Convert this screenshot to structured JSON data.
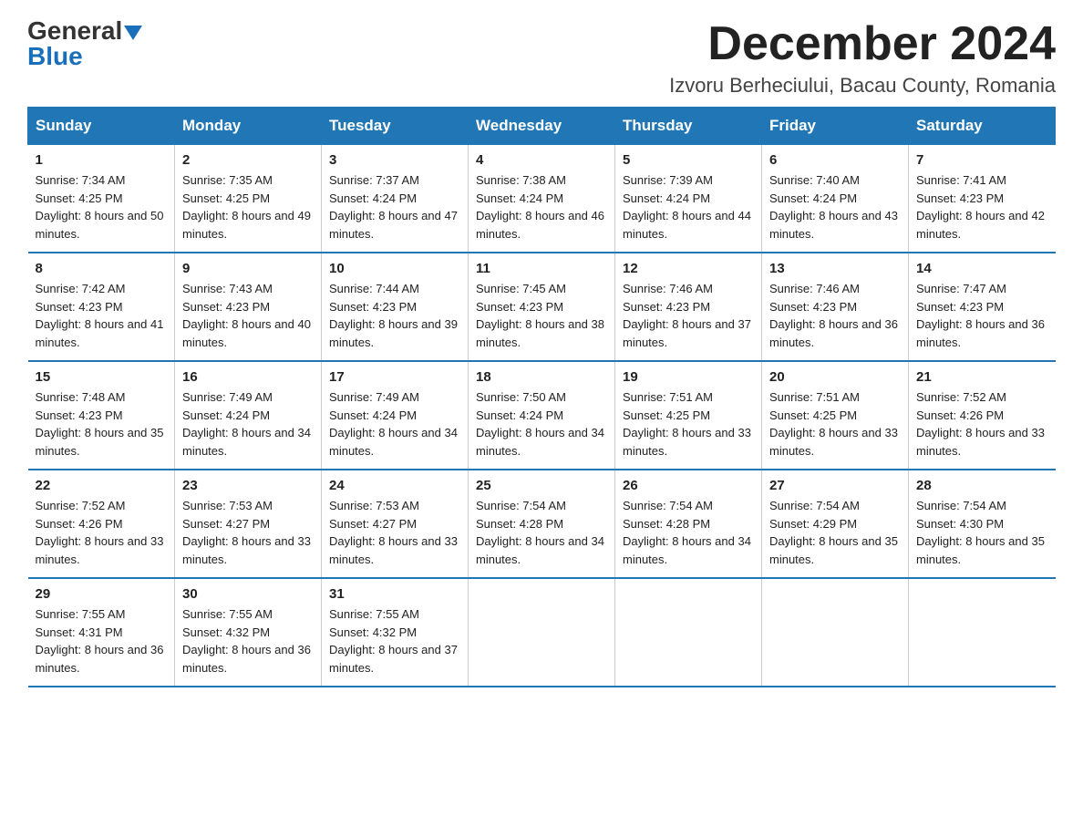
{
  "header": {
    "logo_line1": "General",
    "logo_line2": "Blue",
    "month_title": "December 2024",
    "location": "Izvoru Berheciului, Bacau County, Romania"
  },
  "days_of_week": [
    "Sunday",
    "Monday",
    "Tuesday",
    "Wednesday",
    "Thursday",
    "Friday",
    "Saturday"
  ],
  "weeks": [
    [
      {
        "day": "1",
        "sunrise": "7:34 AM",
        "sunset": "4:25 PM",
        "daylight": "8 hours and 50 minutes."
      },
      {
        "day": "2",
        "sunrise": "7:35 AM",
        "sunset": "4:25 PM",
        "daylight": "8 hours and 49 minutes."
      },
      {
        "day": "3",
        "sunrise": "7:37 AM",
        "sunset": "4:24 PM",
        "daylight": "8 hours and 47 minutes."
      },
      {
        "day": "4",
        "sunrise": "7:38 AM",
        "sunset": "4:24 PM",
        "daylight": "8 hours and 46 minutes."
      },
      {
        "day": "5",
        "sunrise": "7:39 AM",
        "sunset": "4:24 PM",
        "daylight": "8 hours and 44 minutes."
      },
      {
        "day": "6",
        "sunrise": "7:40 AM",
        "sunset": "4:24 PM",
        "daylight": "8 hours and 43 minutes."
      },
      {
        "day": "7",
        "sunrise": "7:41 AM",
        "sunset": "4:23 PM",
        "daylight": "8 hours and 42 minutes."
      }
    ],
    [
      {
        "day": "8",
        "sunrise": "7:42 AM",
        "sunset": "4:23 PM",
        "daylight": "8 hours and 41 minutes."
      },
      {
        "day": "9",
        "sunrise": "7:43 AM",
        "sunset": "4:23 PM",
        "daylight": "8 hours and 40 minutes."
      },
      {
        "day": "10",
        "sunrise": "7:44 AM",
        "sunset": "4:23 PM",
        "daylight": "8 hours and 39 minutes."
      },
      {
        "day": "11",
        "sunrise": "7:45 AM",
        "sunset": "4:23 PM",
        "daylight": "8 hours and 38 minutes."
      },
      {
        "day": "12",
        "sunrise": "7:46 AM",
        "sunset": "4:23 PM",
        "daylight": "8 hours and 37 minutes."
      },
      {
        "day": "13",
        "sunrise": "7:46 AM",
        "sunset": "4:23 PM",
        "daylight": "8 hours and 36 minutes."
      },
      {
        "day": "14",
        "sunrise": "7:47 AM",
        "sunset": "4:23 PM",
        "daylight": "8 hours and 36 minutes."
      }
    ],
    [
      {
        "day": "15",
        "sunrise": "7:48 AM",
        "sunset": "4:23 PM",
        "daylight": "8 hours and 35 minutes."
      },
      {
        "day": "16",
        "sunrise": "7:49 AM",
        "sunset": "4:24 PM",
        "daylight": "8 hours and 34 minutes."
      },
      {
        "day": "17",
        "sunrise": "7:49 AM",
        "sunset": "4:24 PM",
        "daylight": "8 hours and 34 minutes."
      },
      {
        "day": "18",
        "sunrise": "7:50 AM",
        "sunset": "4:24 PM",
        "daylight": "8 hours and 34 minutes."
      },
      {
        "day": "19",
        "sunrise": "7:51 AM",
        "sunset": "4:25 PM",
        "daylight": "8 hours and 33 minutes."
      },
      {
        "day": "20",
        "sunrise": "7:51 AM",
        "sunset": "4:25 PM",
        "daylight": "8 hours and 33 minutes."
      },
      {
        "day": "21",
        "sunrise": "7:52 AM",
        "sunset": "4:26 PM",
        "daylight": "8 hours and 33 minutes."
      }
    ],
    [
      {
        "day": "22",
        "sunrise": "7:52 AM",
        "sunset": "4:26 PM",
        "daylight": "8 hours and 33 minutes."
      },
      {
        "day": "23",
        "sunrise": "7:53 AM",
        "sunset": "4:27 PM",
        "daylight": "8 hours and 33 minutes."
      },
      {
        "day": "24",
        "sunrise": "7:53 AM",
        "sunset": "4:27 PM",
        "daylight": "8 hours and 33 minutes."
      },
      {
        "day": "25",
        "sunrise": "7:54 AM",
        "sunset": "4:28 PM",
        "daylight": "8 hours and 34 minutes."
      },
      {
        "day": "26",
        "sunrise": "7:54 AM",
        "sunset": "4:28 PM",
        "daylight": "8 hours and 34 minutes."
      },
      {
        "day": "27",
        "sunrise": "7:54 AM",
        "sunset": "4:29 PM",
        "daylight": "8 hours and 35 minutes."
      },
      {
        "day": "28",
        "sunrise": "7:54 AM",
        "sunset": "4:30 PM",
        "daylight": "8 hours and 35 minutes."
      }
    ],
    [
      {
        "day": "29",
        "sunrise": "7:55 AM",
        "sunset": "4:31 PM",
        "daylight": "8 hours and 36 minutes."
      },
      {
        "day": "30",
        "sunrise": "7:55 AM",
        "sunset": "4:32 PM",
        "daylight": "8 hours and 36 minutes."
      },
      {
        "day": "31",
        "sunrise": "7:55 AM",
        "sunset": "4:32 PM",
        "daylight": "8 hours and 37 minutes."
      },
      null,
      null,
      null,
      null
    ]
  ]
}
